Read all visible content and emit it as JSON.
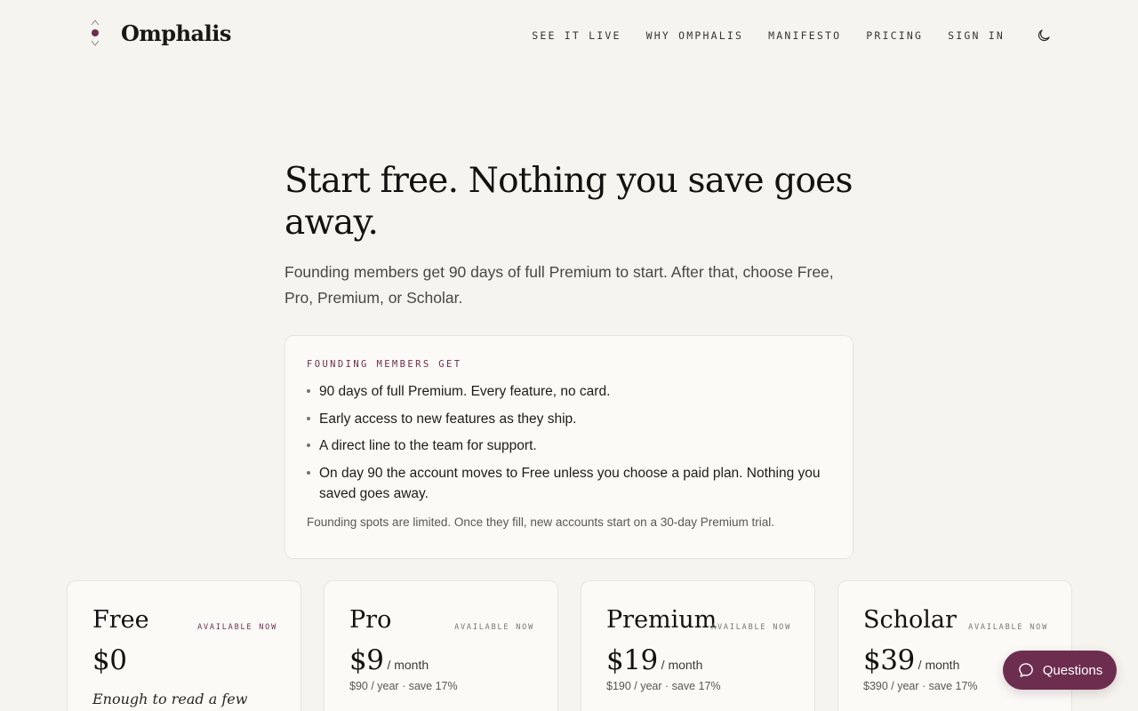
{
  "brand": {
    "name": "Omphalis",
    "accent": "#6d2d4f"
  },
  "nav": {
    "items": [
      "SEE IT LIVE",
      "WHY OMPHALIS",
      "MANIFESTO",
      "PRICING",
      "SIGN IN"
    ],
    "theme_icon": "moon-icon"
  },
  "hero": {
    "title": "Start free. Nothing you save goes away.",
    "subtitle": "Founding members get 90 days of full Premium to start. After that, choose Free, Pro, Premium, or Scholar."
  },
  "founding": {
    "label": "FOUNDING MEMBERS GET",
    "items": [
      "90 days of full Premium. Every feature, no card.",
      "Early access to new features as they ship.",
      "A direct line to the team for support.",
      "On day 90 the account moves to Free unless you choose a paid plan. Nothing you saved goes away."
    ],
    "note": "Founding spots are limited. Once they fill, new accounts start on a 30-day Premium trial."
  },
  "plans": [
    {
      "name": "Free",
      "badge": "AVAILABLE NOW",
      "price": "$0",
      "period": "",
      "annual": "",
      "desc": "Enough to read a few"
    },
    {
      "name": "Pro",
      "badge": "AVAILABLE NOW",
      "price": "$9",
      "period": "/ month",
      "annual": "$90 / year · save 17%",
      "desc": ""
    },
    {
      "name": "Premium",
      "badge": "AVAILABLE NOW",
      "price": "$19",
      "period": "/ month",
      "annual": "$190 / year · save 17%",
      "desc": ""
    },
    {
      "name": "Scholar",
      "badge": "AVAILABLE NOW",
      "price": "$39",
      "period": "/ month",
      "annual": "$390 / year · save 17%",
      "desc": ""
    }
  ],
  "questions": {
    "label": "Questions",
    "icon": "chat-bubble-icon"
  }
}
